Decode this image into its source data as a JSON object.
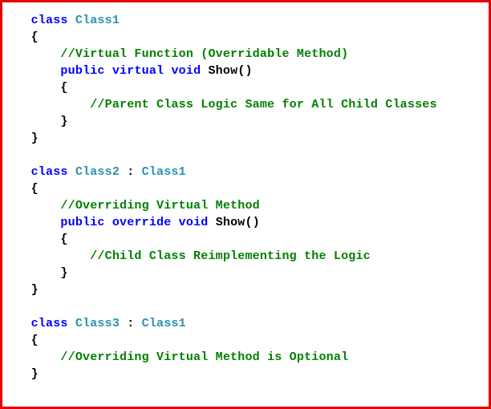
{
  "kw": {
    "class": "class",
    "public": "public",
    "virtual": "virtual",
    "override": "override",
    "void": "void"
  },
  "types": {
    "c1": "Class1",
    "c2": "Class2",
    "c3": "Class3"
  },
  "idents": {
    "method": "Show"
  },
  "punct": {
    "lbrace": "{",
    "rbrace": "}",
    "colon_inherit": " : ",
    "parens": "()"
  },
  "comments": {
    "c1a": "//Virtual Function (Overridable Method)",
    "c1b": "//Parent Class Logic Same for All Child Classes",
    "c2a": "//Overriding Virtual Method",
    "c2b": "//Child Class Reimplementing the Logic",
    "c3a": "//Overriding Virtual Method is Optional"
  }
}
